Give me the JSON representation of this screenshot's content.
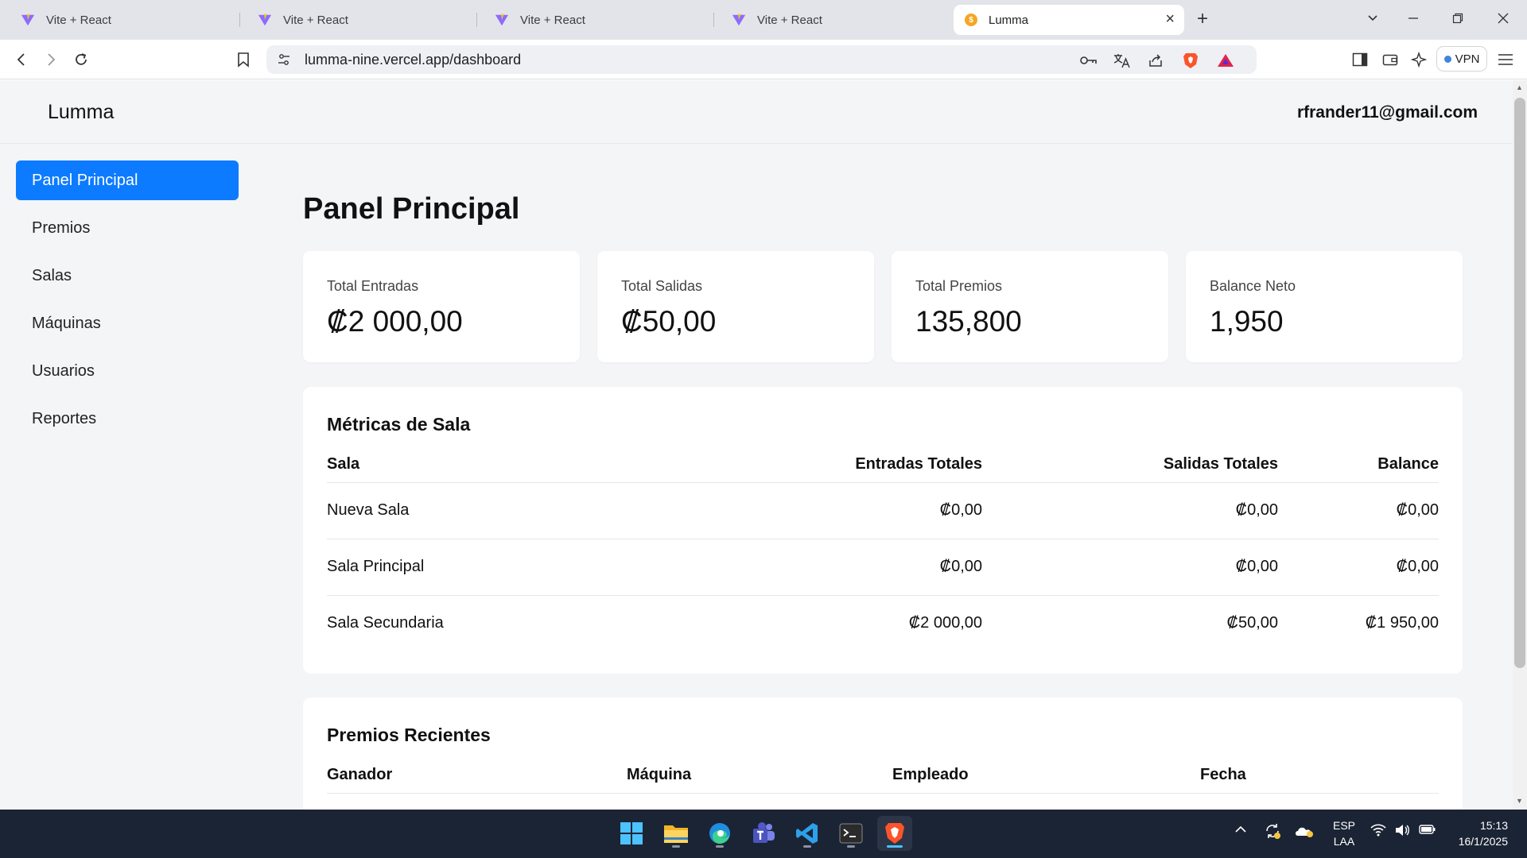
{
  "browser": {
    "tabs": [
      {
        "title": "Vite + React",
        "active": false
      },
      {
        "title": "Vite + React",
        "active": false
      },
      {
        "title": "Vite + React",
        "active": false
      },
      {
        "title": "Vite + React",
        "active": false
      },
      {
        "title": "Lumma",
        "active": true
      }
    ],
    "url": "lumma-nine.vercel.app/dashboard",
    "vpn_label": "VPN"
  },
  "app": {
    "brand": "Lumma",
    "user_email": "rfrander11@gmail.com"
  },
  "sidebar": {
    "items": [
      {
        "label": "Panel Principal",
        "active": true
      },
      {
        "label": "Premios",
        "active": false
      },
      {
        "label": "Salas",
        "active": false
      },
      {
        "label": "Máquinas",
        "active": false
      },
      {
        "label": "Usuarios",
        "active": false
      },
      {
        "label": "Reportes",
        "active": false
      }
    ]
  },
  "main": {
    "title": "Panel Principal",
    "stats": [
      {
        "label": "Total Entradas",
        "value": "₡2 000,00"
      },
      {
        "label": "Total Salidas",
        "value": "₡50,00"
      },
      {
        "label": "Total Premios",
        "value": "135,800"
      },
      {
        "label": "Balance Neto",
        "value": "1,950"
      }
    ],
    "metrics": {
      "title": "Métricas de Sala",
      "headers": [
        "Sala",
        "Entradas Totales",
        "Salidas Totales",
        "Balance"
      ],
      "rows": [
        [
          "Nueva Sala",
          "₡0,00",
          "₡0,00",
          "₡0,00"
        ],
        [
          "Sala Principal",
          "₡0,00",
          "₡0,00",
          "₡0,00"
        ],
        [
          "Sala Secundaria",
          "₡2 000,00",
          "₡50,00",
          "₡1 950,00"
        ]
      ]
    },
    "recent_prizes": {
      "title": "Premios Recientes",
      "headers": [
        "Ganador",
        "Máquina",
        "Empleado",
        "Fecha"
      ]
    }
  },
  "taskbar": {
    "language": {
      "line1": "ESP",
      "line2": "LAA"
    },
    "time": "15:13",
    "date": "16/1/2025"
  },
  "colors": {
    "accent": "#0d7bff",
    "page_bg": "#f4f5f7",
    "taskbar_bg": "#1b2434"
  }
}
